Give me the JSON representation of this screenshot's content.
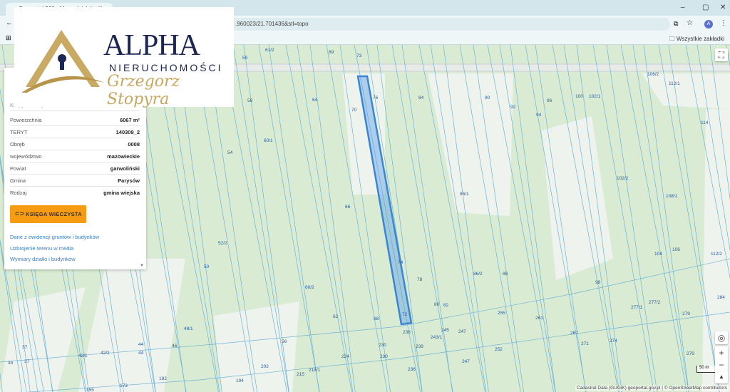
{
  "browser": {
    "tab_title": "Geoportal 360 - Mapa działek - K",
    "address": ".960023/21.701436&stl=topo",
    "bookmarks_all": "Wszystkie zakładki",
    "profile_initial": "A",
    "win_min": "–",
    "win_max": "▢",
    "win_close": "✕"
  },
  "logo": {
    "brand": "ALPHA",
    "subtitle": "NIERUCHOMOŚCI",
    "signature": "Grzegorz Stopyra"
  },
  "panel": {
    "partial_row": {
      "label": "Księga wieczysta",
      "value": ""
    },
    "rows": [
      {
        "label": "Powierzchnia",
        "value": "6067 m²"
      },
      {
        "label": "TERYT",
        "value": "140309_2"
      },
      {
        "label": "Obręb",
        "value": "0008"
      },
      {
        "label": "województwo",
        "value": "mazowieckie"
      },
      {
        "label": "Powiat",
        "value": "garwoliński"
      },
      {
        "label": "Gmina",
        "value": "Parysów"
      },
      {
        "label": "Rodzaj",
        "value": "gmina wiejska"
      }
    ],
    "button": "KSIĘGA WIECZYSTA",
    "links": [
      "Dane z ewidencji gruntów i budynków",
      "Uzbrojenie terenu w media",
      "Wymiary działki i budynków"
    ]
  },
  "map": {
    "selected_parcel": "74",
    "colors": {
      "land": "#d9ecd3",
      "lines": "#6fb3d6",
      "selected": "#3a86d4",
      "labels": "#2a5a9a"
    },
    "parcel_labels": [
      "59",
      "61/2",
      "69",
      "73",
      "106/2",
      "112/1",
      "58",
      "64",
      "76",
      "84",
      "90",
      "92",
      "96",
      "100",
      "102/1",
      "94",
      "70",
      "114",
      "60/1",
      "54",
      "102/2",
      "108/1",
      "86/1",
      "66",
      "52/2",
      "50",
      "74",
      "78",
      "86/2",
      "88",
      "104",
      "106",
      "112/2",
      "98",
      "60/2",
      "277/2",
      "277/1",
      "284",
      "80",
      "82",
      "72",
      "62",
      "68",
      "255",
      "261",
      "279",
      "236",
      "245",
      "247",
      "243/1",
      "48/1",
      "267",
      "271",
      "274",
      "56",
      "230",
      "239",
      "44",
      "44",
      "46",
      "37",
      "42/1",
      "42/2",
      "37",
      "34",
      "224",
      "230",
      "252",
      "279",
      "247",
      "202",
      "218/1",
      "215",
      "236",
      "182",
      "194",
      "173",
      "155"
    ],
    "scale": "50 m",
    "attribution": "Cadastral Data (GUGiK) geoportal.gov.pl | © OpenStreetMap contributors",
    "controls": {
      "fullscreen": "⛶",
      "locate": "◎",
      "zoom_in": "+",
      "zoom_out": "−",
      "north": "▲"
    }
  }
}
